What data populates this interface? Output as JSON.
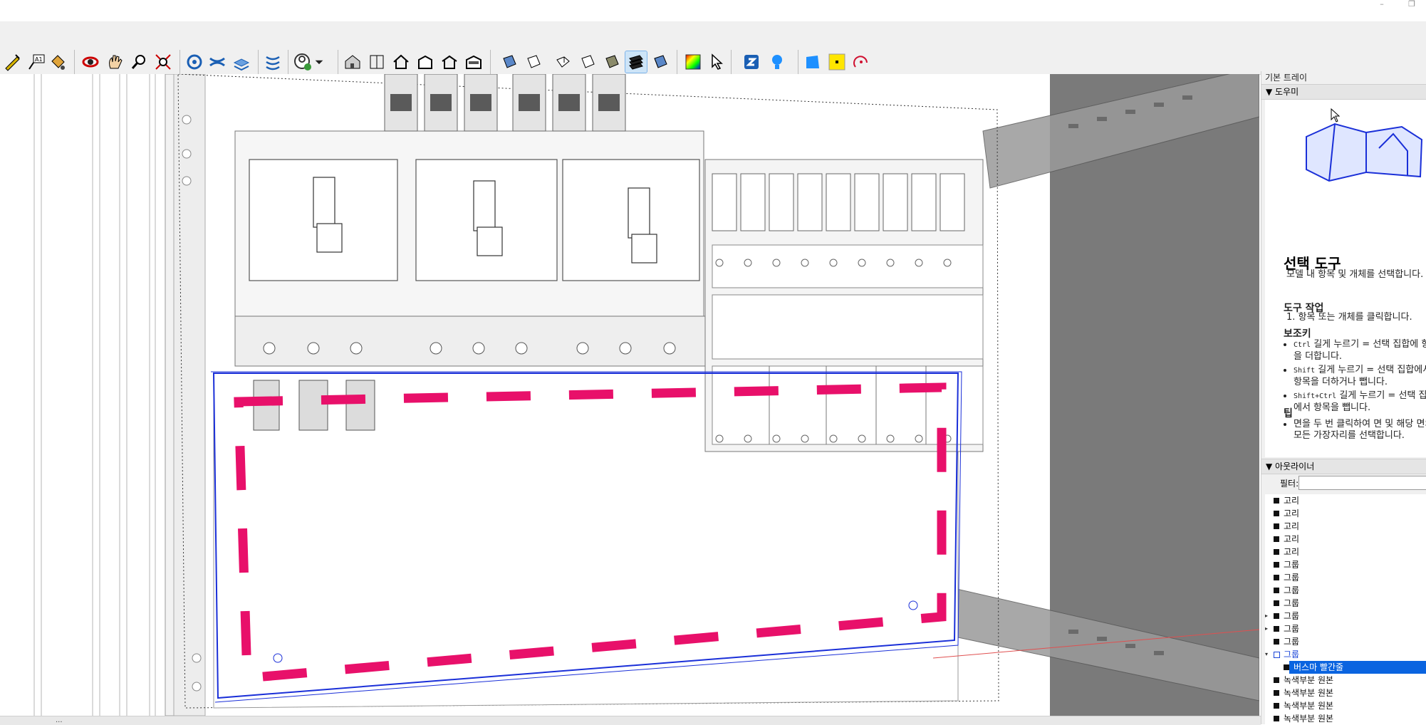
{
  "window": {
    "minimize": "–",
    "restore": "❐"
  },
  "toolbar": {
    "icons": [
      "measure-tool",
      "text-tool",
      "paint-bucket",
      "orbit",
      "pan",
      "zoom",
      "zoom-extents",
      "position-camera",
      "walk",
      "look-around",
      "section-plane",
      "user-account",
      "iso-view",
      "top-view",
      "front-view",
      "right-view",
      "back-view",
      "left-view",
      "xray-style",
      "wireframe-style",
      "hidden-line-style",
      "shaded-style",
      "shaded-textures-style",
      "monochrome-style",
      "color-swatch",
      "select-tool",
      "sketchup-extension",
      "lightbulb",
      "blue-face",
      "yellow-square",
      "arc-tool"
    ],
    "active": "shaded-textures-style"
  },
  "tray": {
    "title": "기본 트레이",
    "instructor": {
      "header": "도우미",
      "heading": "선택 도구",
      "desc": "모델 내 항목 및 개체를 선택합니다.",
      "ops_title": "도구 작업",
      "ops": [
        "항목 또는 개체를 클릭합니다."
      ],
      "mods_title": "보조키",
      "mods": [
        {
          "key": "Ctrl",
          "text": " 길게 누르기 = 선택 집합에 항목을 더합니다."
        },
        {
          "key": "Shift",
          "text": " 길게 누르기 = 선택 집합에서 항목을 더하거나 뺍니다."
        },
        {
          "key": "Shift+Ctrl",
          "text": " 길게 누르기 = 선택 집합에서 항목을 뺍니다."
        }
      ],
      "tips_title": "팁",
      "tips": [
        "면을 두 번 클릭하여 면 및 해당 면의 모든 가장자리를 선택합니다."
      ]
    },
    "outliner": {
      "header": "아웃라이너",
      "filter_label": "필터:",
      "filter_value": "",
      "items": [
        {
          "label": "고리",
          "exp": "",
          "indent": 0
        },
        {
          "label": "고리",
          "exp": "",
          "indent": 0
        },
        {
          "label": "고리",
          "exp": "",
          "indent": 0
        },
        {
          "label": "고리",
          "exp": "",
          "indent": 0
        },
        {
          "label": "고리",
          "exp": "",
          "indent": 0
        },
        {
          "label": "그룹",
          "exp": "",
          "indent": 0
        },
        {
          "label": "그룹",
          "exp": "",
          "indent": 0
        },
        {
          "label": "그룹",
          "exp": "",
          "indent": 0
        },
        {
          "label": "그룹",
          "exp": "",
          "indent": 0
        },
        {
          "label": "그룹",
          "exp": "▸",
          "indent": 0
        },
        {
          "label": "그룹",
          "exp": "▸",
          "indent": 0
        },
        {
          "label": "그룹",
          "exp": "",
          "indent": 0
        },
        {
          "label": "그룹",
          "exp": "▾",
          "indent": 0,
          "state": "open"
        },
        {
          "label": "버스마 빨간줄",
          "exp": "",
          "indent": 1,
          "state": "selected"
        },
        {
          "label": "녹색부분 원본",
          "exp": "",
          "indent": 0
        },
        {
          "label": "녹색부분 원본",
          "exp": "",
          "indent": 0
        },
        {
          "label": "녹색부분 원본",
          "exp": "",
          "indent": 0
        },
        {
          "label": "녹색부분 원본",
          "exp": "",
          "indent": 0
        }
      ]
    }
  },
  "colors": {
    "dash": "#e8106a",
    "selection": "#1a2fd8",
    "select_bg": "#0a64e0",
    "shade": "#7a7a7a"
  },
  "status": {
    "text": "..."
  }
}
